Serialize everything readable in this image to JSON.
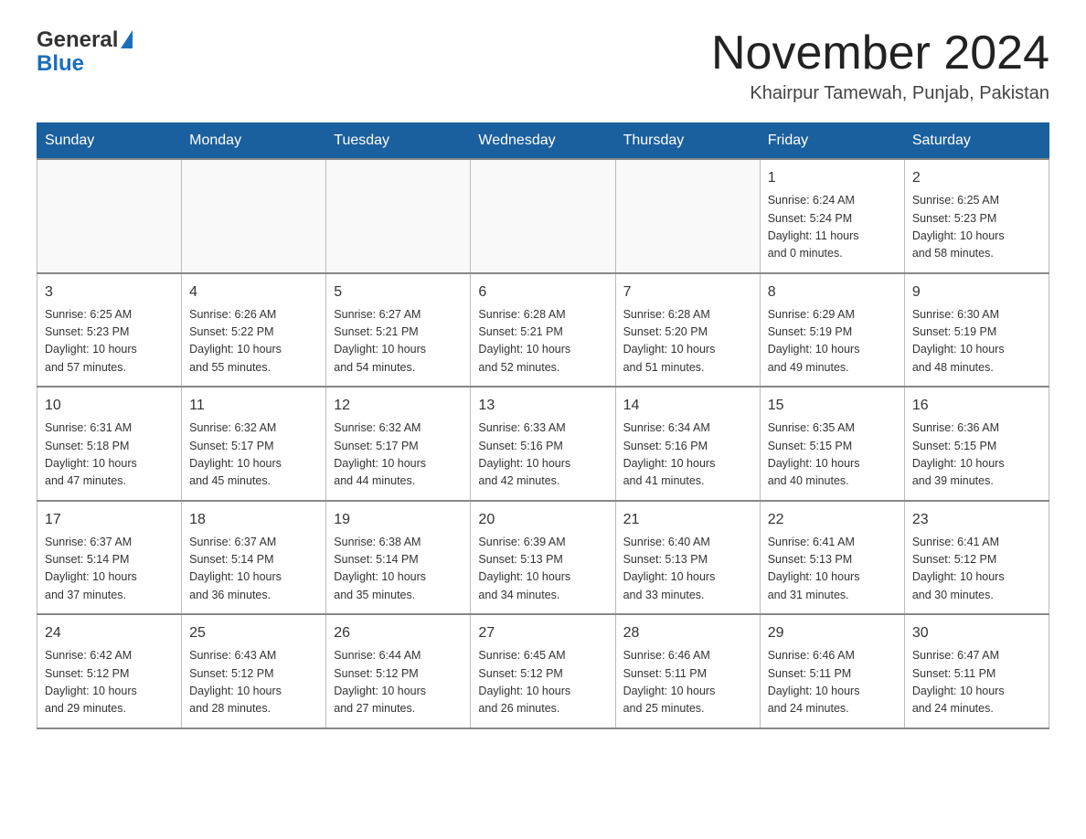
{
  "header": {
    "logo_general": "General",
    "logo_blue": "Blue",
    "month_title": "November 2024",
    "location": "Khairpur Tamewah, Punjab, Pakistan"
  },
  "days_of_week": [
    "Sunday",
    "Monday",
    "Tuesday",
    "Wednesday",
    "Thursday",
    "Friday",
    "Saturday"
  ],
  "weeks": [
    [
      {
        "day": "",
        "info": ""
      },
      {
        "day": "",
        "info": ""
      },
      {
        "day": "",
        "info": ""
      },
      {
        "day": "",
        "info": ""
      },
      {
        "day": "",
        "info": ""
      },
      {
        "day": "1",
        "info": "Sunrise: 6:24 AM\nSunset: 5:24 PM\nDaylight: 11 hours\nand 0 minutes."
      },
      {
        "day": "2",
        "info": "Sunrise: 6:25 AM\nSunset: 5:23 PM\nDaylight: 10 hours\nand 58 minutes."
      }
    ],
    [
      {
        "day": "3",
        "info": "Sunrise: 6:25 AM\nSunset: 5:23 PM\nDaylight: 10 hours\nand 57 minutes."
      },
      {
        "day": "4",
        "info": "Sunrise: 6:26 AM\nSunset: 5:22 PM\nDaylight: 10 hours\nand 55 minutes."
      },
      {
        "day": "5",
        "info": "Sunrise: 6:27 AM\nSunset: 5:21 PM\nDaylight: 10 hours\nand 54 minutes."
      },
      {
        "day": "6",
        "info": "Sunrise: 6:28 AM\nSunset: 5:21 PM\nDaylight: 10 hours\nand 52 minutes."
      },
      {
        "day": "7",
        "info": "Sunrise: 6:28 AM\nSunset: 5:20 PM\nDaylight: 10 hours\nand 51 minutes."
      },
      {
        "day": "8",
        "info": "Sunrise: 6:29 AM\nSunset: 5:19 PM\nDaylight: 10 hours\nand 49 minutes."
      },
      {
        "day": "9",
        "info": "Sunrise: 6:30 AM\nSunset: 5:19 PM\nDaylight: 10 hours\nand 48 minutes."
      }
    ],
    [
      {
        "day": "10",
        "info": "Sunrise: 6:31 AM\nSunset: 5:18 PM\nDaylight: 10 hours\nand 47 minutes."
      },
      {
        "day": "11",
        "info": "Sunrise: 6:32 AM\nSunset: 5:17 PM\nDaylight: 10 hours\nand 45 minutes."
      },
      {
        "day": "12",
        "info": "Sunrise: 6:32 AM\nSunset: 5:17 PM\nDaylight: 10 hours\nand 44 minutes."
      },
      {
        "day": "13",
        "info": "Sunrise: 6:33 AM\nSunset: 5:16 PM\nDaylight: 10 hours\nand 42 minutes."
      },
      {
        "day": "14",
        "info": "Sunrise: 6:34 AM\nSunset: 5:16 PM\nDaylight: 10 hours\nand 41 minutes."
      },
      {
        "day": "15",
        "info": "Sunrise: 6:35 AM\nSunset: 5:15 PM\nDaylight: 10 hours\nand 40 minutes."
      },
      {
        "day": "16",
        "info": "Sunrise: 6:36 AM\nSunset: 5:15 PM\nDaylight: 10 hours\nand 39 minutes."
      }
    ],
    [
      {
        "day": "17",
        "info": "Sunrise: 6:37 AM\nSunset: 5:14 PM\nDaylight: 10 hours\nand 37 minutes."
      },
      {
        "day": "18",
        "info": "Sunrise: 6:37 AM\nSunset: 5:14 PM\nDaylight: 10 hours\nand 36 minutes."
      },
      {
        "day": "19",
        "info": "Sunrise: 6:38 AM\nSunset: 5:14 PM\nDaylight: 10 hours\nand 35 minutes."
      },
      {
        "day": "20",
        "info": "Sunrise: 6:39 AM\nSunset: 5:13 PM\nDaylight: 10 hours\nand 34 minutes."
      },
      {
        "day": "21",
        "info": "Sunrise: 6:40 AM\nSunset: 5:13 PM\nDaylight: 10 hours\nand 33 minutes."
      },
      {
        "day": "22",
        "info": "Sunrise: 6:41 AM\nSunset: 5:13 PM\nDaylight: 10 hours\nand 31 minutes."
      },
      {
        "day": "23",
        "info": "Sunrise: 6:41 AM\nSunset: 5:12 PM\nDaylight: 10 hours\nand 30 minutes."
      }
    ],
    [
      {
        "day": "24",
        "info": "Sunrise: 6:42 AM\nSunset: 5:12 PM\nDaylight: 10 hours\nand 29 minutes."
      },
      {
        "day": "25",
        "info": "Sunrise: 6:43 AM\nSunset: 5:12 PM\nDaylight: 10 hours\nand 28 minutes."
      },
      {
        "day": "26",
        "info": "Sunrise: 6:44 AM\nSunset: 5:12 PM\nDaylight: 10 hours\nand 27 minutes."
      },
      {
        "day": "27",
        "info": "Sunrise: 6:45 AM\nSunset: 5:12 PM\nDaylight: 10 hours\nand 26 minutes."
      },
      {
        "day": "28",
        "info": "Sunrise: 6:46 AM\nSunset: 5:11 PM\nDaylight: 10 hours\nand 25 minutes."
      },
      {
        "day": "29",
        "info": "Sunrise: 6:46 AM\nSunset: 5:11 PM\nDaylight: 10 hours\nand 24 minutes."
      },
      {
        "day": "30",
        "info": "Sunrise: 6:47 AM\nSunset: 5:11 PM\nDaylight: 10 hours\nand 24 minutes."
      }
    ]
  ]
}
